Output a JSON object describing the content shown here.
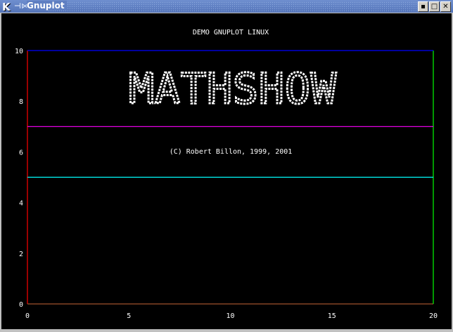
{
  "window": {
    "title": "Gnuplot",
    "app_icon": "kde-k-icon",
    "buttons": [
      "minimize",
      "maximize",
      "close"
    ]
  },
  "chart_data": {
    "type": "line",
    "title": "DEMO GNUPLOT LINUX",
    "banner": "MATHSHOW",
    "copyright": "(C) Robert Billon, 1999, 2001",
    "xlim": [
      0,
      20
    ],
    "ylim": [
      0,
      10
    ],
    "xticks": [
      "0",
      "5",
      "10",
      "15",
      "20"
    ],
    "yticks": [
      "0",
      "2",
      "4",
      "6",
      "8",
      "10"
    ],
    "series": [
      {
        "name": "left",
        "color": "#ff0000",
        "points": [
          [
            0,
            0
          ],
          [
            0,
            10
          ]
        ]
      },
      {
        "name": "bottom",
        "color": "#a0522d",
        "points": [
          [
            0,
            0
          ],
          [
            20,
            0
          ]
        ]
      },
      {
        "name": "right",
        "color": "#00ff00",
        "points": [
          [
            20,
            0
          ],
          [
            20,
            10
          ]
        ]
      },
      {
        "name": "top",
        "color": "#0000ff",
        "points": [
          [
            0,
            10
          ],
          [
            20,
            10
          ]
        ]
      },
      {
        "name": "magenta",
        "color": "#ff00ff",
        "points": [
          [
            0,
            7
          ],
          [
            20,
            7
          ]
        ]
      },
      {
        "name": "cyan",
        "color": "#00ffff",
        "points": [
          [
            0,
            5
          ],
          [
            20,
            5
          ]
        ]
      }
    ]
  }
}
